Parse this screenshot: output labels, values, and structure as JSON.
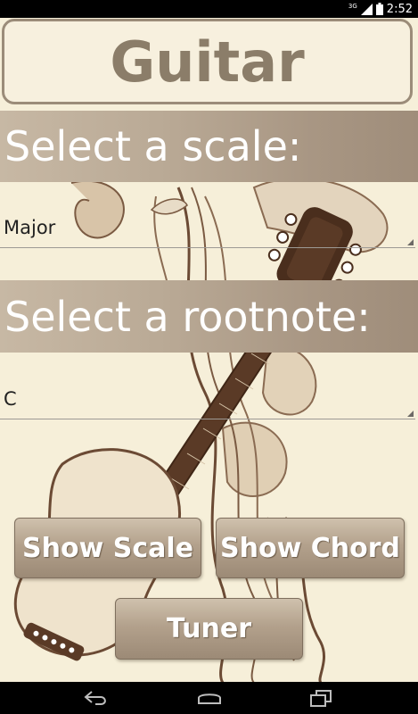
{
  "status_bar": {
    "network": "3G",
    "time": "2:52",
    "icons": [
      "signal-icon",
      "battery-icon"
    ]
  },
  "app": {
    "title": "Guitar"
  },
  "scale_section": {
    "header": "Select a scale:",
    "selected": "Major"
  },
  "rootnote_section": {
    "header": "Select a rootnote:",
    "selected": "C"
  },
  "buttons": {
    "show_scale": "Show Scale",
    "show_chord": "Show Chord",
    "tuner": "Tuner"
  },
  "nav_bar": {
    "icons": [
      "back-icon",
      "home-icon",
      "recent-apps-icon"
    ]
  },
  "colors": {
    "background": "#f6efd9",
    "header_gradient_start": "#c7b8a4",
    "header_gradient_end": "#9f8d7a",
    "title_text": "#8b7d69",
    "art_brown": "#6b4a34"
  }
}
